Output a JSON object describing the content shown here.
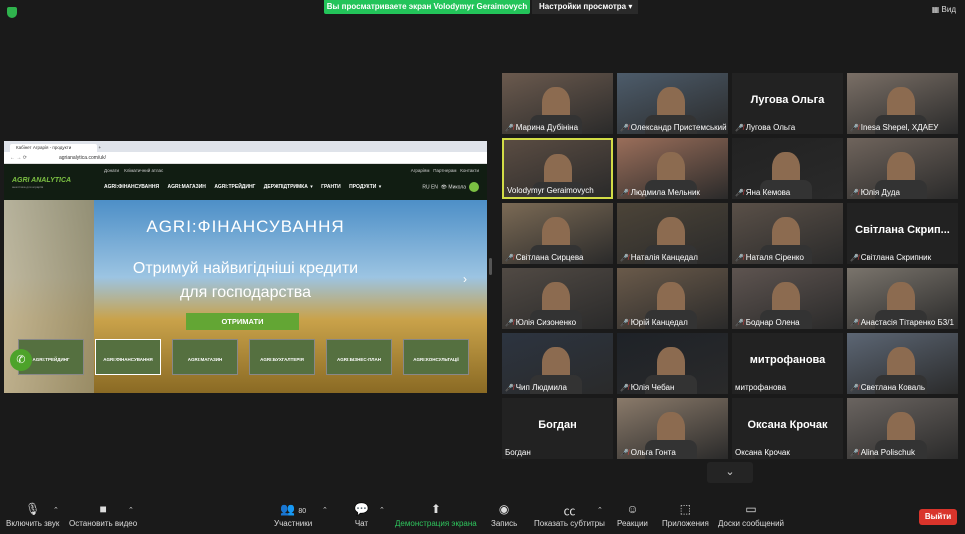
{
  "topbar": {
    "banner": "Вы просматриваете экран Volodymyr Geraimovych",
    "view_options": "Настройки просмотра",
    "view_button": "Вид"
  },
  "browser": {
    "tab_title": "Кабінет Аграрія - продукти",
    "url": "agrianalytica.com/uk/"
  },
  "site": {
    "logo": "AGRI ANALYTICA",
    "logo_sub": "аналітика для аграріїв",
    "top_links_left": [
      "Донати",
      "Кліматичний атлас"
    ],
    "top_links_right": [
      "Аграріям",
      "Партнерам",
      "Контакти"
    ],
    "nav": [
      "AGRI:ФІНАНСУВАННЯ",
      "AGRI:МАГАЗИН",
      "AGRI:ТРЕЙДИНГ",
      "ДЕРЖПІДТРИМКА ▾",
      "ГРАНТИ",
      "ПРОДУКТИ ▾"
    ],
    "lang": "RU EN",
    "user": "Микола",
    "hero_title": "AGRI:ФІНАНСУВАННЯ",
    "hero_sub1": "Отримуй найвигідніші кредити",
    "hero_sub2": "для господарства",
    "cta": "ОТРИМАТИ",
    "cards": [
      "AGRI:ТРЕЙДИНГ",
      "AGRI:ФІНАНСУВАННЯ",
      "AGRI:МАГАЗИН",
      "AGRI:БУХГАЛТЕРІЯ",
      "AGRI:БІЗНЕС-ПЛАН",
      "AGRI:КОНСУЛЬТАЦІЇ"
    ]
  },
  "participants": [
    {
      "name": "Марина Дубініна",
      "big": ""
    },
    {
      "name": "Олександр Пристемський",
      "big": ""
    },
    {
      "name": "Лугова Ольга",
      "big": "Лугова Ольга"
    },
    {
      "name": "Inesa Shepel, ХДАЕУ",
      "big": ""
    },
    {
      "name": "Volodymyr Geraimovych",
      "big": ""
    },
    {
      "name": "Людмила Мельник",
      "big": ""
    },
    {
      "name": "Яна Кемова",
      "big": ""
    },
    {
      "name": "Юлія Дуда",
      "big": ""
    },
    {
      "name": "Світлана Сирцева",
      "big": ""
    },
    {
      "name": "Наталія Канцедал",
      "big": ""
    },
    {
      "name": "Наталя Сіренко",
      "big": ""
    },
    {
      "name": "Світлана Скрипник",
      "big": "Світлана Скрип..."
    },
    {
      "name": "Юлія Сизоненко",
      "big": ""
    },
    {
      "name": "Юрій Канцедал",
      "big": ""
    },
    {
      "name": "Боднар Олена",
      "big": ""
    },
    {
      "name": "Анастасія Тітаренко Б3/1",
      "big": ""
    },
    {
      "name": "Чип Людмила",
      "big": ""
    },
    {
      "name": "Юлія Чебан",
      "big": ""
    },
    {
      "name": "митрофанова",
      "big": "митрофанова"
    },
    {
      "name": "Светлана Коваль",
      "big": ""
    },
    {
      "name": "Богдан",
      "big": "Богдан"
    },
    {
      "name": "Ольга Гонта",
      "big": ""
    },
    {
      "name": "Оксана Крочак",
      "big": "Оксана Крочак"
    },
    {
      "name": "Alina Polischuk",
      "big": ""
    }
  ],
  "toolbar": {
    "unmute": "Включить звук",
    "stop_video": "Остановить видео",
    "participants": "Участники",
    "participants_count": "80",
    "chat": "Чат",
    "share": "Демонстрация экрана",
    "record": "Запись",
    "captions": "Показать субтитры",
    "reactions": "Реакции",
    "apps": "Приложения",
    "whiteboards": "Доски сообщений",
    "exit": "Выйти"
  }
}
